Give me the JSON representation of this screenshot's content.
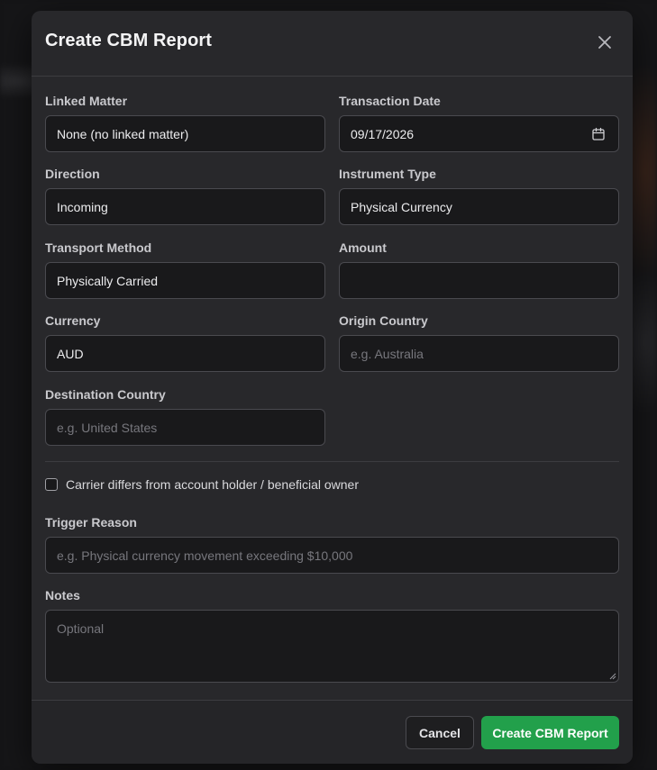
{
  "modal": {
    "title": "Create CBM Report"
  },
  "fields": {
    "linked_matter": {
      "label": "Linked Matter",
      "value": "None (no linked matter)"
    },
    "transaction_date": {
      "label": "Transaction Date",
      "value": "09/17/2026"
    },
    "direction": {
      "label": "Direction",
      "value": "Incoming"
    },
    "instrument_type": {
      "label": "Instrument Type",
      "value": "Physical Currency"
    },
    "transport_method": {
      "label": "Transport Method",
      "value": "Physically Carried"
    },
    "amount": {
      "label": "Amount",
      "value": ""
    },
    "currency": {
      "label": "Currency",
      "value": "AUD"
    },
    "origin_country": {
      "label": "Origin Country",
      "placeholder": "e.g. Australia"
    },
    "destination_country": {
      "label": "Destination Country",
      "placeholder": "e.g. United States"
    },
    "carrier_differs": {
      "label": "Carrier differs from account holder / beneficial owner",
      "checked": false
    },
    "trigger_reason": {
      "label": "Trigger Reason",
      "placeholder": "e.g. Physical currency movement exceeding $10,000"
    },
    "notes": {
      "label": "Notes",
      "placeholder": "Optional"
    }
  },
  "footer": {
    "cancel_label": "Cancel",
    "submit_label": "Create CBM Report"
  },
  "icons": {
    "close": "close-icon",
    "calendar": "calendar-icon"
  },
  "colors": {
    "primary": "#22a04b",
    "modal_bg": "#28282b",
    "input_bg": "#19191b"
  }
}
